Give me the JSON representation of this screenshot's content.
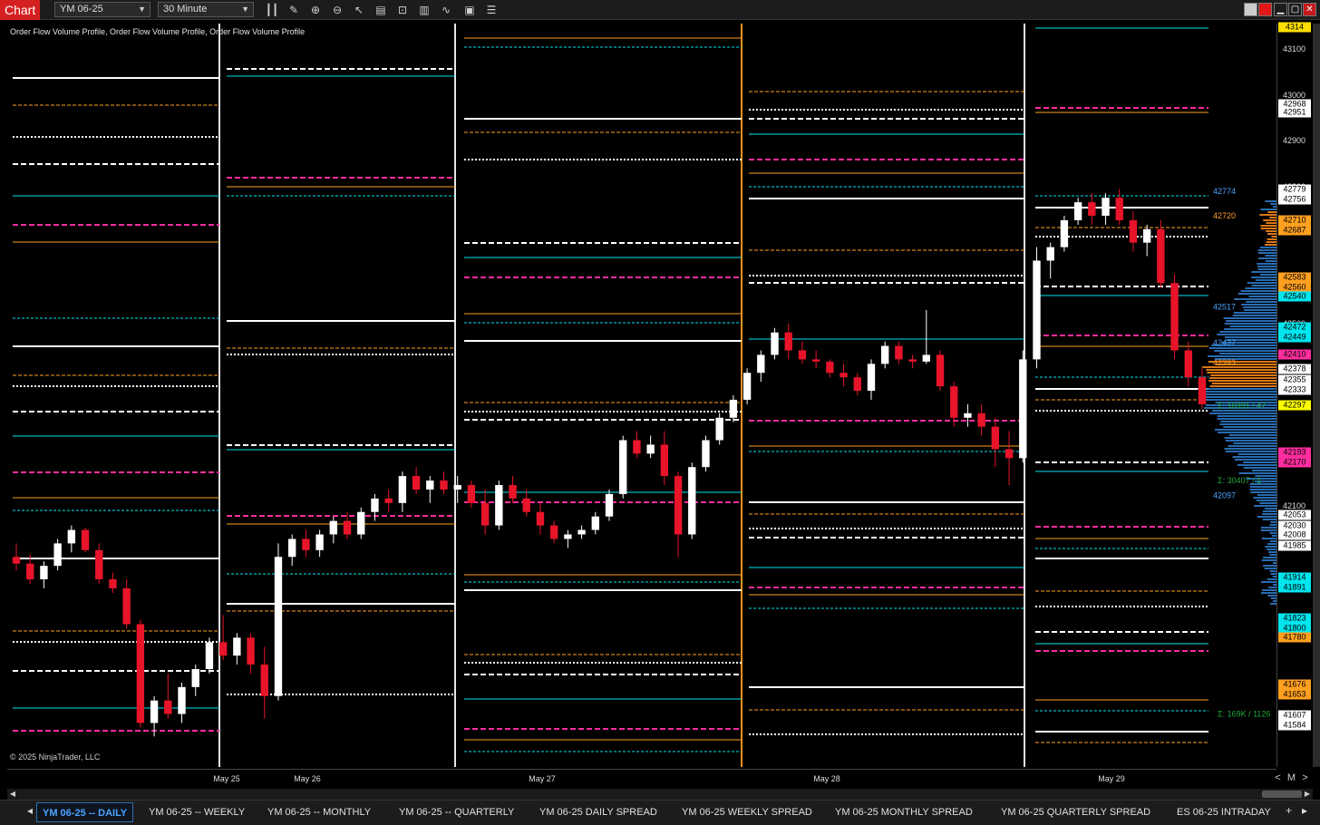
{
  "toolbar": {
    "app_label": "Chart",
    "instrument": "YM 06-25",
    "interval": "30 Minute",
    "icons": [
      "bar-type-icon",
      "draw-pencil-icon",
      "zoom-in-icon",
      "zoom-out-icon",
      "pointer-icon",
      "data-box-icon",
      "indicators-icon",
      "strategies-icon",
      "analysis-icon",
      "properties-icon",
      "list-icon"
    ],
    "window_buttons": [
      "link-icon",
      "color-link-icon",
      "minimize-icon",
      "maximize-icon",
      "close-icon"
    ]
  },
  "chart": {
    "indicator_label": "Order Flow Volume Profile, Order Flow Volume Profile, Order Flow Volume Profile",
    "copyright": "© 2025 NinjaTrader, LLC",
    "time_labels": [
      "May 25",
      "May 26",
      "May 27",
      "May 28",
      "May 29"
    ],
    "volume_labels": [
      "Σ: 16391 / 47",
      "Σ: 30407 / 1",
      "Σ: 169K / 1126"
    ]
  },
  "chart_data": {
    "type": "candlestick",
    "instrument": "YM 06-25",
    "interval": "30 Minute",
    "ylim": [
      41500,
      43140
    ],
    "y_ticks": [
      41700,
      42100,
      42500,
      42600,
      42800,
      42900,
      43000,
      43100
    ],
    "profile_level_labels": [
      {
        "text": "42774",
        "color": "#4aa3ff"
      },
      {
        "text": "42720",
        "color": "#ff9d2e"
      },
      {
        "text": "42517",
        "color": "#4aa3ff"
      },
      {
        "text": "42437",
        "color": "#4aa3ff"
      },
      {
        "text": "42393",
        "color": "#ff9d2e"
      },
      {
        "text": "42097",
        "color": "#4aa3ff"
      }
    ],
    "price_markers": [
      {
        "value": 43140,
        "label": "4314",
        "color": "#ffe000"
      },
      {
        "value": 42968,
        "label": "42968",
        "color": "#ffffff"
      },
      {
        "value": 42951,
        "label": "42951",
        "color": "#ffffff"
      },
      {
        "value": 42779,
        "label": "42779",
        "color": "#ffffff"
      },
      {
        "value": 42756,
        "label": "42756",
        "color": "#ffffff"
      },
      {
        "value": 42710,
        "label": "42710",
        "color": "#ffa020"
      },
      {
        "value": 42687,
        "label": "42687",
        "color": "#ffa020"
      },
      {
        "value": 42583,
        "label": "42583",
        "color": "#ffa020"
      },
      {
        "value": 42560,
        "label": "42560",
        "color": "#ffa020"
      },
      {
        "value": 42540,
        "label": "42540",
        "color": "#00e5ee"
      },
      {
        "value": 42472,
        "label": "42472",
        "color": "#00e5ee"
      },
      {
        "value": 42449,
        "label": "42449",
        "color": "#00e5ee"
      },
      {
        "value": 42410,
        "label": "42410",
        "color": "#ff2d9e"
      },
      {
        "value": 42378,
        "label": "42378",
        "color": "#ffffff"
      },
      {
        "value": 42355,
        "label": "42355",
        "color": "#ffffff"
      },
      {
        "value": 42333,
        "label": "42333",
        "color": "#ffffff"
      },
      {
        "value": 42297,
        "label": "42297",
        "color": "#ffff00"
      },
      {
        "value": 42193,
        "label": "42193",
        "color": "#ff2d9e"
      },
      {
        "value": 42170,
        "label": "42170",
        "color": "#ff2d9e"
      },
      {
        "value": 42053,
        "label": "42053",
        "color": "#ffffff"
      },
      {
        "value": 42030,
        "label": "42030",
        "color": "#ffffff"
      },
      {
        "value": 42008,
        "label": "42008",
        "color": "#ffffff"
      },
      {
        "value": 41985,
        "label": "41985",
        "color": "#ffffff"
      },
      {
        "value": 41914,
        "label": "41914",
        "color": "#00e5ee"
      },
      {
        "value": 41891,
        "label": "41891",
        "color": "#00e5ee"
      },
      {
        "value": 41823,
        "label": "41823",
        "color": "#00e5ee"
      },
      {
        "value": 41800,
        "label": "41800",
        "color": "#00e5ee"
      },
      {
        "value": 41780,
        "label": "41780",
        "color": "#ffa020"
      },
      {
        "value": 41676,
        "label": "41676",
        "color": "#ffa020"
      },
      {
        "value": 41653,
        "label": "41653",
        "color": "#ffa020"
      },
      {
        "value": 41607,
        "label": "41607",
        "color": "#ffffff"
      },
      {
        "value": 41584,
        "label": "41584",
        "color": "#ffffff"
      }
    ],
    "candles": [
      [
        41960,
        41990,
        41930,
        41945
      ],
      [
        41945,
        41965,
        41900,
        41910
      ],
      [
        41910,
        41950,
        41890,
        41940
      ],
      [
        41940,
        42000,
        41930,
        41990
      ],
      [
        41990,
        42030,
        41970,
        42020
      ],
      [
        42020,
        42025,
        41970,
        41975
      ],
      [
        41975,
        41990,
        41900,
        41910
      ],
      [
        41910,
        41925,
        41880,
        41890
      ],
      [
        41890,
        41910,
        41800,
        41810
      ],
      [
        41810,
        41820,
        41580,
        41590
      ],
      [
        41590,
        41650,
        41560,
        41640
      ],
      [
        41640,
        41700,
        41600,
        41610
      ],
      [
        41610,
        41680,
        41590,
        41670
      ],
      [
        41670,
        41720,
        41650,
        41710
      ],
      [
        41710,
        41780,
        41700,
        41770
      ],
      [
        41770,
        41830,
        41730,
        41740
      ],
      [
        41740,
        41790,
        41720,
        41780
      ],
      [
        41780,
        41790,
        41700,
        41720
      ],
      [
        41720,
        41760,
        41600,
        41650
      ],
      [
        41650,
        41990,
        41640,
        41960
      ],
      [
        41960,
        42010,
        41940,
        42000
      ],
      [
        42000,
        42020,
        41960,
        41975
      ],
      [
        41975,
        42020,
        41960,
        42010
      ],
      [
        42010,
        42050,
        41990,
        42040
      ],
      [
        42040,
        42060,
        42000,
        42010
      ],
      [
        42010,
        42070,
        42000,
        42060
      ],
      [
        42060,
        42100,
        42040,
        42090
      ],
      [
        42090,
        42110,
        42060,
        42080
      ],
      [
        42080,
        42150,
        42060,
        42140
      ],
      [
        42140,
        42160,
        42100,
        42110
      ],
      [
        42110,
        42140,
        42080,
        42130
      ],
      [
        42130,
        42150,
        42100,
        42110
      ],
      [
        42110,
        42140,
        42080,
        42120
      ],
      [
        42120,
        42130,
        42070,
        42080
      ],
      [
        42080,
        42110,
        42010,
        42030
      ],
      [
        42030,
        42130,
        42020,
        42120
      ],
      [
        42120,
        42140,
        42080,
        42090
      ],
      [
        42090,
        42110,
        42050,
        42060
      ],
      [
        42060,
        42080,
        42010,
        42030
      ],
      [
        42030,
        42040,
        41990,
        42000
      ],
      [
        42000,
        42020,
        41980,
        42010
      ],
      [
        42010,
        42030,
        42000,
        42020
      ],
      [
        42020,
        42060,
        42010,
        42050
      ],
      [
        42050,
        42110,
        42040,
        42100
      ],
      [
        42100,
        42230,
        42090,
        42220
      ],
      [
        42220,
        42240,
        42180,
        42190
      ],
      [
        42190,
        42230,
        42180,
        42210
      ],
      [
        42210,
        42240,
        42120,
        42140
      ],
      [
        42140,
        42150,
        41960,
        42010
      ],
      [
        42010,
        42170,
        42000,
        42160
      ],
      [
        42160,
        42230,
        42150,
        42220
      ],
      [
        42220,
        42280,
        42210,
        42270
      ],
      [
        42270,
        42320,
        42260,
        42310
      ],
      [
        42310,
        42380,
        42300,
        42370
      ],
      [
        42370,
        42420,
        42350,
        42410
      ],
      [
        42410,
        42470,
        42400,
        42460
      ],
      [
        42460,
        42480,
        42400,
        42420
      ],
      [
        42420,
        42440,
        42390,
        42400
      ],
      [
        42400,
        42420,
        42380,
        42395
      ],
      [
        42395,
        42400,
        42360,
        42370
      ],
      [
        42370,
        42390,
        42340,
        42360
      ],
      [
        42360,
        42370,
        42320,
        42330
      ],
      [
        42330,
        42400,
        42310,
        42390
      ],
      [
        42390,
        42440,
        42380,
        42430
      ],
      [
        42430,
        42440,
        42390,
        42400
      ],
      [
        42400,
        42410,
        42380,
        42395
      ],
      [
        42395,
        42510,
        42390,
        42410
      ],
      [
        42410,
        42420,
        42330,
        42340
      ],
      [
        42340,
        42350,
        42250,
        42270
      ],
      [
        42270,
        42300,
        42250,
        42280
      ],
      [
        42280,
        42300,
        42230,
        42250
      ],
      [
        42250,
        42270,
        42160,
        42200
      ],
      [
        42200,
        42240,
        42120,
        42180
      ],
      [
        42180,
        42420,
        42170,
        42400
      ],
      [
        42400,
        42650,
        42380,
        42620
      ],
      [
        42620,
        42660,
        42580,
        42650
      ],
      [
        42650,
        42720,
        42640,
        42710
      ],
      [
        42710,
        42760,
        42700,
        42750
      ],
      [
        42750,
        42770,
        42700,
        42720
      ],
      [
        42720,
        42770,
        42700,
        42760
      ],
      [
        42760,
        42780,
        42700,
        42710
      ],
      [
        42710,
        42730,
        42640,
        42660
      ],
      [
        42660,
        42700,
        42630,
        42690
      ],
      [
        42690,
        42710,
        42560,
        42570
      ],
      [
        42570,
        42590,
        42400,
        42420
      ],
      [
        42420,
        42440,
        42340,
        42360
      ],
      [
        42360,
        42380,
        42290,
        42300
      ]
    ]
  },
  "price_axis": {
    "tick_labels": [
      "43100",
      "43000",
      "42900",
      "42800",
      "42600",
      "42500",
      "42100",
      "41700"
    ]
  },
  "zoom_controls": [
    "<",
    "M",
    ">"
  ],
  "tabs": [
    {
      "label": "YM 06-25 -- DAILY",
      "active": true
    },
    {
      "label": "YM 06-25 -- WEEKLY",
      "active": false
    },
    {
      "label": "YM 06-25 -- MONTHLY",
      "active": false
    },
    {
      "label": "YM 06-25 -- QUARTERLY",
      "active": false
    },
    {
      "label": "YM 06-25 DAILY SPREAD",
      "active": false
    },
    {
      "label": "YM 06-25 WEEKLY SPREAD",
      "active": false
    },
    {
      "label": "YM 06-25 MONTHLY SPREAD",
      "active": false
    },
    {
      "label": "YM 06-25 QUARTERLY SPREAD",
      "active": false
    },
    {
      "label": "ES 06-25 INTRADAY",
      "active": false
    }
  ],
  "colors": {
    "up_candle": "#ffffff",
    "down_candle": "#e8142a",
    "accent_red": "#d42020",
    "white_level": "#ffffff",
    "orange_level": "#ffa020",
    "cyan_level": "#00e5ee",
    "magenta_level": "#ff2d9e",
    "profile_blue": "#2f7fd0",
    "profile_orange": "#ff8c1a"
  }
}
